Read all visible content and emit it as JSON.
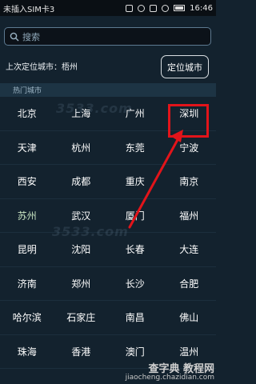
{
  "status": {
    "carrier": "未插入SIM卡3",
    "time": "16:46"
  },
  "search": {
    "placeholder": "搜索"
  },
  "last_city": {
    "label": "上次定位城市：梧州"
  },
  "locate_button": "定位城市",
  "section": "热门城市",
  "cities": [
    "北京",
    "上海",
    "广州",
    "深圳",
    "天津",
    "杭州",
    "东莞",
    "宁波",
    "西安",
    "成都",
    "重庆",
    "南京",
    "苏州",
    "武汉",
    "厦门",
    "福州",
    "昆明",
    "沈阳",
    "长春",
    "大连",
    "济南",
    "郑州",
    "长沙",
    "合肥",
    "哈尔滨",
    "石家庄",
    "南昌",
    "佛山",
    "珠海",
    "香港",
    "澳门",
    "温州"
  ],
  "watermark": {
    "site": "3533.com",
    "brand": "查字典 教程网",
    "url": "jiaocheng.chazidian.com"
  },
  "colors": {
    "highlight": "#e2141a",
    "arrow": "#e2141a"
  }
}
